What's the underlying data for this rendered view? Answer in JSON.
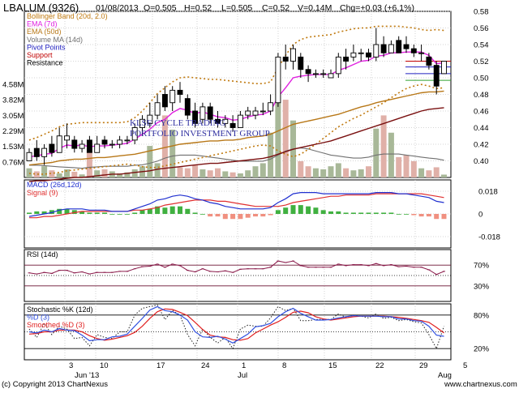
{
  "header": {
    "symbol": "LBALUM (9326)",
    "date": "01/08/2013",
    "open": "O=0.505",
    "high": "H=0.52",
    "low": "L=0.505",
    "close": "C=0.52",
    "volume": "V=0.14M",
    "change": "Chg=+0.03 (+6.1%)"
  },
  "watermark": {
    "line1": "KLSE CYCLE TRADING",
    "line2": "PORTFOLIO INVESTMENT GROUP"
  },
  "footer": {
    "copyright": "(c) Copyright 2013 ChartNexus",
    "url": "www.chartnexus.com"
  },
  "colors": {
    "bollinger": "#c07a10",
    "ema7": "#e020e0",
    "ema50": "#b87818",
    "volume_ma": "#707070",
    "pivot": "#2020c0",
    "support": "#c00000",
    "ema_long": "#7a1010",
    "volume_bar": "#a8b898",
    "macd": "#2030d0",
    "signal": "#e03030",
    "hist_pos": "#40b040",
    "hist_neg": "#f09080",
    "rsi": "#8a1a4a",
    "stoch_k": "#202020",
    "stoch_d": "#3050e0",
    "stoch_smooth": "#e02020"
  },
  "chart_data": [
    {
      "type": "candlestick",
      "title": "LBALUM (9326)",
      "legend": [
        "Bollinger Band (20d, 2.0)",
        "EMA (7d)",
        "EMA (50d)",
        "Volume MA (14d)",
        "Pivot Points",
        "Support",
        "Resistance"
      ],
      "x_tick_labels": [
        "3",
        "10",
        "17",
        "24",
        "1",
        "8",
        "15",
        "22",
        "29",
        "5"
      ],
      "x_month_labels": [
        "Jun '13",
        "Jul",
        "Aug"
      ],
      "y_ticks": [
        "0.58",
        "0.56",
        "0.54",
        "0.52",
        "0.50",
        "0.48",
        "0.46",
        "0.44",
        "0.42",
        "0.40"
      ],
      "ylim": [
        0.38,
        0.58
      ],
      "volume_ticks": [
        "4.58M",
        "3.82M",
        "3.05M",
        "2.29M",
        "1.53M",
        "0.76M"
      ],
      "volume_max": 4.58,
      "candles": [
        {
          "o": 0.4,
          "h": 0.415,
          "l": 0.4,
          "c": 0.41
        },
        {
          "o": 0.415,
          "h": 0.425,
          "l": 0.4,
          "c": 0.405
        },
        {
          "o": 0.405,
          "h": 0.42,
          "l": 0.395,
          "c": 0.415
        },
        {
          "o": 0.42,
          "h": 0.43,
          "l": 0.405,
          "c": 0.41
        },
        {
          "o": 0.41,
          "h": 0.44,
          "l": 0.41,
          "c": 0.43
        },
        {
          "o": 0.425,
          "h": 0.445,
          "l": 0.415,
          "c": 0.43
        },
        {
          "o": 0.425,
          "h": 0.43,
          "l": 0.41,
          "c": 0.415
        },
        {
          "o": 0.415,
          "h": 0.425,
          "l": 0.41,
          "c": 0.42
        },
        {
          "o": 0.425,
          "h": 0.43,
          "l": 0.41,
          "c": 0.41
        },
        {
          "o": 0.41,
          "h": 0.43,
          "l": 0.41,
          "c": 0.42
        },
        {
          "o": 0.425,
          "h": 0.43,
          "l": 0.415,
          "c": 0.42
        },
        {
          "o": 0.42,
          "h": 0.425,
          "l": 0.415,
          "c": 0.42
        },
        {
          "o": 0.42,
          "h": 0.43,
          "l": 0.415,
          "c": 0.425
        },
        {
          "o": 0.425,
          "h": 0.43,
          "l": 0.42,
          "c": 0.425
        },
        {
          "o": 0.425,
          "h": 0.445,
          "l": 0.42,
          "c": 0.44
        },
        {
          "o": 0.44,
          "h": 0.455,
          "l": 0.43,
          "c": 0.45
        },
        {
          "o": 0.445,
          "h": 0.47,
          "l": 0.44,
          "c": 0.455
        },
        {
          "o": 0.455,
          "h": 0.48,
          "l": 0.45,
          "c": 0.47
        },
        {
          "o": 0.48,
          "h": 0.49,
          "l": 0.46,
          "c": 0.465
        },
        {
          "o": 0.47,
          "h": 0.49,
          "l": 0.46,
          "c": 0.485
        },
        {
          "o": 0.485,
          "h": 0.495,
          "l": 0.47,
          "c": 0.48
        },
        {
          "o": 0.475,
          "h": 0.48,
          "l": 0.45,
          "c": 0.455
        },
        {
          "o": 0.46,
          "h": 0.47,
          "l": 0.44,
          "c": 0.445
        },
        {
          "o": 0.45,
          "h": 0.47,
          "l": 0.445,
          "c": 0.465
        },
        {
          "o": 0.465,
          "h": 0.47,
          "l": 0.445,
          "c": 0.45
        },
        {
          "o": 0.45,
          "h": 0.46,
          "l": 0.44,
          "c": 0.445
        },
        {
          "o": 0.445,
          "h": 0.455,
          "l": 0.44,
          "c": 0.45
        },
        {
          "o": 0.445,
          "h": 0.455,
          "l": 0.435,
          "c": 0.44
        },
        {
          "o": 0.44,
          "h": 0.46,
          "l": 0.44,
          "c": 0.455
        },
        {
          "o": 0.455,
          "h": 0.465,
          "l": 0.45,
          "c": 0.46
        },
        {
          "o": 0.455,
          "h": 0.465,
          "l": 0.45,
          "c": 0.46
        },
        {
          "o": 0.46,
          "h": 0.47,
          "l": 0.455,
          "c": 0.46
        },
        {
          "o": 0.46,
          "h": 0.48,
          "l": 0.455,
          "c": 0.47
        },
        {
          "o": 0.47,
          "h": 0.53,
          "l": 0.465,
          "c": 0.525
        },
        {
          "o": 0.525,
          "h": 0.54,
          "l": 0.51,
          "c": 0.52
        },
        {
          "o": 0.52,
          "h": 0.54,
          "l": 0.51,
          "c": 0.535
        },
        {
          "o": 0.525,
          "h": 0.53,
          "l": 0.5,
          "c": 0.51
        },
        {
          "o": 0.51,
          "h": 0.515,
          "l": 0.495,
          "c": 0.505
        },
        {
          "o": 0.505,
          "h": 0.51,
          "l": 0.5,
          "c": 0.505
        },
        {
          "o": 0.505,
          "h": 0.51,
          "l": 0.5,
          "c": 0.505
        },
        {
          "o": 0.5,
          "h": 0.51,
          "l": 0.5,
          "c": 0.505
        },
        {
          "o": 0.505,
          "h": 0.53,
          "l": 0.5,
          "c": 0.525
        },
        {
          "o": 0.525,
          "h": 0.535,
          "l": 0.51,
          "c": 0.52
        },
        {
          "o": 0.525,
          "h": 0.54,
          "l": 0.52,
          "c": 0.53
        },
        {
          "o": 0.53,
          "h": 0.535,
          "l": 0.52,
          "c": 0.53
        },
        {
          "o": 0.53,
          "h": 0.535,
          "l": 0.52,
          "c": 0.525
        },
        {
          "o": 0.525,
          "h": 0.56,
          "l": 0.52,
          "c": 0.54
        },
        {
          "o": 0.54,
          "h": 0.55,
          "l": 0.525,
          "c": 0.53
        },
        {
          "o": 0.53,
          "h": 0.545,
          "l": 0.53,
          "c": 0.54
        },
        {
          "o": 0.545,
          "h": 0.55,
          "l": 0.53,
          "c": 0.53
        },
        {
          "o": 0.54,
          "h": 0.55,
          "l": 0.53,
          "c": 0.535
        },
        {
          "o": 0.535,
          "h": 0.54,
          "l": 0.525,
          "c": 0.53
        },
        {
          "o": 0.53,
          "h": 0.54,
          "l": 0.52,
          "c": 0.53
        },
        {
          "o": 0.525,
          "h": 0.53,
          "l": 0.51,
          "c": 0.515
        },
        {
          "o": 0.515,
          "h": 0.52,
          "l": 0.48,
          "c": 0.49
        },
        {
          "o": 0.505,
          "h": 0.52,
          "l": 0.505,
          "c": 0.52
        }
      ],
      "ema7": [
        0.405,
        0.406,
        0.408,
        0.409,
        0.415,
        0.419,
        0.418,
        0.419,
        0.417,
        0.418,
        0.418,
        0.419,
        0.42,
        0.421,
        0.426,
        0.432,
        0.438,
        0.446,
        0.45,
        0.458,
        0.463,
        0.461,
        0.457,
        0.459,
        0.456,
        0.453,
        0.452,
        0.449,
        0.45,
        0.453,
        0.455,
        0.456,
        0.46,
        0.477,
        0.488,
        0.5,
        0.502,
        0.503,
        0.504,
        0.504,
        0.504,
        0.509,
        0.512,
        0.516,
        0.52,
        0.521,
        0.526,
        0.527,
        0.53,
        0.53,
        0.531,
        0.531,
        0.531,
        0.527,
        0.517,
        0.518
      ],
      "ema50": [
        0.395,
        0.396,
        0.397,
        0.398,
        0.4,
        0.401,
        0.402,
        0.402,
        0.403,
        0.404,
        0.404,
        0.405,
        0.406,
        0.407,
        0.408,
        0.41,
        0.412,
        0.414,
        0.416,
        0.418,
        0.42,
        0.421,
        0.422,
        0.423,
        0.424,
        0.424,
        0.425,
        0.425,
        0.426,
        0.428,
        0.429,
        0.43,
        0.432,
        0.436,
        0.44,
        0.444,
        0.446,
        0.448,
        0.45,
        0.452,
        0.454,
        0.456,
        0.459,
        0.462,
        0.465,
        0.467,
        0.47,
        0.472,
        0.474,
        0.476,
        0.478,
        0.48,
        0.482,
        0.483,
        0.483,
        0.484
      ],
      "ema_long": [
        0.375,
        0.376,
        0.376,
        0.377,
        0.378,
        0.379,
        0.38,
        0.38,
        0.381,
        0.382,
        0.383,
        0.384,
        0.384,
        0.385,
        0.386,
        0.387,
        0.388,
        0.39,
        0.391,
        0.392,
        0.393,
        0.394,
        0.395,
        0.396,
        0.397,
        0.397,
        0.398,
        0.399,
        0.4,
        0.401,
        0.402,
        0.403,
        0.405,
        0.408,
        0.411,
        0.414,
        0.416,
        0.418,
        0.42,
        0.422,
        0.424,
        0.427,
        0.43,
        0.433,
        0.436,
        0.439,
        0.442,
        0.445,
        0.448,
        0.451,
        0.454,
        0.457,
        0.46,
        0.462,
        0.463,
        0.464
      ],
      "bb_upper": [
        0.425,
        0.428,
        0.432,
        0.436,
        0.441,
        0.444,
        0.445,
        0.446,
        0.446,
        0.446,
        0.446,
        0.446,
        0.446,
        0.447,
        0.452,
        0.46,
        0.47,
        0.481,
        0.488,
        0.495,
        0.5,
        0.501,
        0.5,
        0.499,
        0.498,
        0.498,
        0.497,
        0.496,
        0.495,
        0.494,
        0.493,
        0.493,
        0.495,
        0.512,
        0.527,
        0.54,
        0.546,
        0.549,
        0.55,
        0.551,
        0.552,
        0.555,
        0.557,
        0.559,
        0.56,
        0.56,
        0.562,
        0.562,
        0.562,
        0.562,
        0.561,
        0.56,
        0.558,
        0.557,
        0.558,
        0.557
      ],
      "bb_lower": [
        0.385,
        0.384,
        0.384,
        0.385,
        0.386,
        0.388,
        0.389,
        0.39,
        0.391,
        0.392,
        0.393,
        0.394,
        0.395,
        0.396,
        0.395,
        0.393,
        0.392,
        0.392,
        0.394,
        0.396,
        0.398,
        0.4,
        0.402,
        0.404,
        0.406,
        0.408,
        0.41,
        0.412,
        0.414,
        0.416,
        0.418,
        0.419,
        0.418,
        0.412,
        0.408,
        0.405,
        0.408,
        0.414,
        0.42,
        0.427,
        0.434,
        0.441,
        0.446,
        0.451,
        0.455,
        0.46,
        0.465,
        0.47,
        0.476,
        0.482,
        0.487,
        0.49,
        0.492,
        0.49,
        0.487,
        0.488
      ],
      "pivot_levels": [
        0.513,
        0.505
      ],
      "support_level": 0.497,
      "resistance_level": 0.52,
      "volume": [
        0.45,
        0.3,
        0.55,
        0.35,
        0.2,
        0.4,
        0.28,
        0.15,
        1.3,
        0.35,
        0.4,
        0.3,
        0.2,
        0.25,
        0.4,
        0.55,
        1.55,
        0.7,
        3.05,
        2.35,
        0.5,
        0.45,
        0.6,
        0.4,
        0.35,
        0.45,
        0.3,
        0.25,
        0.2,
        0.35,
        0.55,
        0.7,
        2.2,
        4.58,
        3.82,
        2.8,
        0.8,
        0.55,
        0.45,
        0.4,
        0.55,
        0.7,
        0.45,
        0.35,
        0.4,
        0.55,
        2.4,
        3.05,
        2.2,
        1.0,
        1.1,
        0.8,
        0.45,
        0.35,
        0.5,
        0.14
      ],
      "volume_ma": [
        0.6,
        0.6,
        0.58,
        0.55,
        0.52,
        0.5,
        0.48,
        0.45,
        0.5,
        0.52,
        0.55,
        0.55,
        0.55,
        0.55,
        0.6,
        0.62,
        0.7,
        0.8,
        0.95,
        1.05,
        1.1,
        1.1,
        1.1,
        1.05,
        1.0,
        0.95,
        0.9,
        0.85,
        0.8,
        0.8,
        0.8,
        0.8,
        0.9,
        1.1,
        1.3,
        1.4,
        1.45,
        1.4,
        1.3,
        1.2,
        1.1,
        1.05,
        1.0,
        0.95,
        0.95,
        1.0,
        1.1,
        1.15,
        1.15,
        1.15,
        1.1,
        1.05,
        1.0,
        0.95,
        0.92,
        0.85
      ]
    },
    {
      "type": "line",
      "title": "MACD (26d,12d)",
      "legend": [
        "MACD (26d,12d)",
        "Signal (9)"
      ],
      "y_ticks": [
        "0.018",
        "0",
        "-0.018"
      ],
      "ylim": [
        -0.027,
        0.027
      ],
      "macd": [
        -0.002,
        -0.001,
        0.0,
        0.001,
        0.003,
        0.004,
        0.004,
        0.004,
        0.003,
        0.003,
        0.003,
        0.002,
        0.002,
        0.002,
        0.004,
        0.006,
        0.008,
        0.011,
        0.012,
        0.014,
        0.015,
        0.014,
        0.012,
        0.011,
        0.009,
        0.008,
        0.006,
        0.005,
        0.004,
        0.004,
        0.004,
        0.004,
        0.005,
        0.009,
        0.012,
        0.016,
        0.017,
        0.017,
        0.017,
        0.016,
        0.016,
        0.016,
        0.016,
        0.016,
        0.016,
        0.016,
        0.017,
        0.017,
        0.017,
        0.016,
        0.016,
        0.015,
        0.014,
        0.013,
        0.01,
        0.009
      ],
      "signal": [
        -0.003,
        -0.003,
        -0.002,
        -0.002,
        -0.001,
        0.0,
        0.001,
        0.002,
        0.002,
        0.002,
        0.002,
        0.002,
        0.002,
        0.002,
        0.003,
        0.003,
        0.004,
        0.005,
        0.007,
        0.008,
        0.009,
        0.01,
        0.011,
        0.011,
        0.011,
        0.01,
        0.01,
        0.009,
        0.008,
        0.007,
        0.006,
        0.006,
        0.006,
        0.006,
        0.007,
        0.009,
        0.01,
        0.011,
        0.012,
        0.013,
        0.014,
        0.014,
        0.015,
        0.015,
        0.015,
        0.015,
        0.016,
        0.016,
        0.016,
        0.016,
        0.016,
        0.016,
        0.016,
        0.015,
        0.014,
        0.013
      ],
      "histogram": [
        0.001,
        0.002,
        0.002,
        0.003,
        0.004,
        0.004,
        0.003,
        0.002,
        0.001,
        0.001,
        0.001,
        0.0,
        0.0,
        0.0,
        0.001,
        0.003,
        0.004,
        0.006,
        0.005,
        0.006,
        0.006,
        0.004,
        0.001,
        0.0,
        -0.002,
        -0.002,
        -0.004,
        -0.004,
        -0.004,
        -0.003,
        -0.002,
        -0.002,
        -0.001,
        0.003,
        0.005,
        0.007,
        0.007,
        0.006,
        0.005,
        0.003,
        0.002,
        0.002,
        0.001,
        0.001,
        0.001,
        0.001,
        0.001,
        0.001,
        0.001,
        0.0,
        0.0,
        -0.001,
        -0.002,
        -0.002,
        -0.004,
        -0.004
      ]
    },
    {
      "type": "line",
      "title": "RSI (14d)",
      "y_ticks": [
        "70%",
        "30%"
      ],
      "ylim": [
        0,
        100
      ],
      "rsi": [
        55,
        53,
        56,
        54,
        60,
        60,
        55,
        57,
        53,
        56,
        56,
        56,
        58,
        58,
        63,
        67,
        68,
        72,
        66,
        72,
        69,
        60,
        57,
        63,
        58,
        57,
        59,
        56,
        62,
        63,
        63,
        63,
        66,
        78,
        75,
        78,
        69,
        66,
        66,
        66,
        66,
        72,
        69,
        71,
        71,
        69,
        73,
        69,
        71,
        67,
        68,
        66,
        66,
        61,
        52,
        58
      ]
    },
    {
      "type": "line",
      "title": "Stochastic %K (12d)",
      "legend": [
        "Stochastic %K (12d)",
        "%D (3)",
        "Smoothed %D (3)"
      ],
      "y_ticks": [
        "80%",
        "20%"
      ],
      "ylim": [
        0,
        100
      ],
      "k": [
        55,
        40,
        65,
        45,
        60,
        55,
        38,
        40,
        25,
        45,
        40,
        38,
        50,
        50,
        80,
        92,
        95,
        98,
        72,
        88,
        80,
        45,
        25,
        55,
        40,
        30,
        40,
        20,
        55,
        62,
        60,
        60,
        75,
        95,
        88,
        92,
        70,
        70,
        72,
        72,
        72,
        82,
        76,
        80,
        78,
        75,
        82,
        74,
        76,
        70,
        72,
        68,
        66,
        45,
        20,
        60
      ],
      "d": [
        50,
        48,
        53,
        50,
        56,
        53,
        52,
        44,
        34,
        36,
        36,
        41,
        42,
        46,
        60,
        74,
        89,
        95,
        88,
        86,
        80,
        71,
        50,
        41,
        40,
        42,
        37,
        30,
        38,
        46,
        59,
        61,
        65,
        77,
        86,
        92,
        83,
        77,
        71,
        71,
        72,
        75,
        77,
        79,
        78,
        78,
        78,
        77,
        77,
        73,
        73,
        70,
        69,
        60,
        44,
        42
      ],
      "smoothed_d": [
        46,
        47,
        50,
        50,
        53,
        53,
        53,
        50,
        43,
        38,
        35,
        37,
        40,
        43,
        49,
        60,
        74,
        86,
        91,
        90,
        85,
        79,
        67,
        54,
        44,
        41,
        40,
        36,
        35,
        38,
        48,
        55,
        62,
        68,
        76,
        85,
        87,
        84,
        77,
        73,
        71,
        73,
        75,
        77,
        78,
        78,
        78,
        78,
        77,
        76,
        74,
        72,
        70,
        67,
        58,
        48
      ]
    }
  ]
}
